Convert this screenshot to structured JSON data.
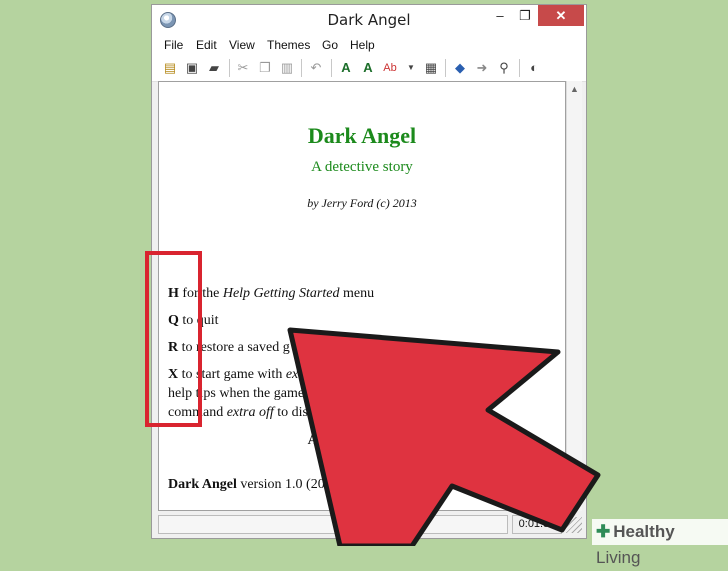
{
  "window": {
    "title": "Dark Angel"
  },
  "window_controls": {
    "minimize": "–",
    "maximize": "❐",
    "close": "✕"
  },
  "menu": [
    "File",
    "Edit",
    "View",
    "Themes",
    "Go",
    "Help"
  ],
  "toolbar_icons": [
    "new-icon",
    "save-icon",
    "open-icon",
    "cut-icon",
    "copy-icon",
    "paste-icon",
    "undo-icon",
    "font-icon",
    "font-bold-icon",
    "spell-check-icon",
    "dropdown-icon",
    "transcript-icon",
    "back-icon",
    "forward-icon",
    "find-icon",
    "speech-icon"
  ],
  "game": {
    "title": "Dark Angel",
    "subtitle": "A detective story",
    "byline": "by Jerry Ford (c) 2013",
    "h_key": "H",
    "h_pre": "for the",
    "h_italic": "Help Getting Started",
    "h_post": "menu",
    "q_key": "Q",
    "q_text": "to quit",
    "r_key": "R",
    "r_text": "to restore a saved g",
    "x_key": "X",
    "x_text": "to start game with",
    "x_italic": "extra",
    "x_line2": "help tips when the game sens",
    "x_line3_pre": "command",
    "x_line3_italic": "extra off",
    "x_line3_post": "to disable)",
    "any_key": "Any other key to s",
    "version_title": "Dark Angel",
    "version_text": "version 1.0 (2013-12-03)"
  },
  "status": {
    "time": "0:01:57"
  },
  "watermark": {
    "text_bold": "Healthy",
    "text": " Living"
  },
  "colors": {
    "accent_red": "#d9242f",
    "game_green": "#1c8a1c",
    "background": "#b5d39f"
  }
}
